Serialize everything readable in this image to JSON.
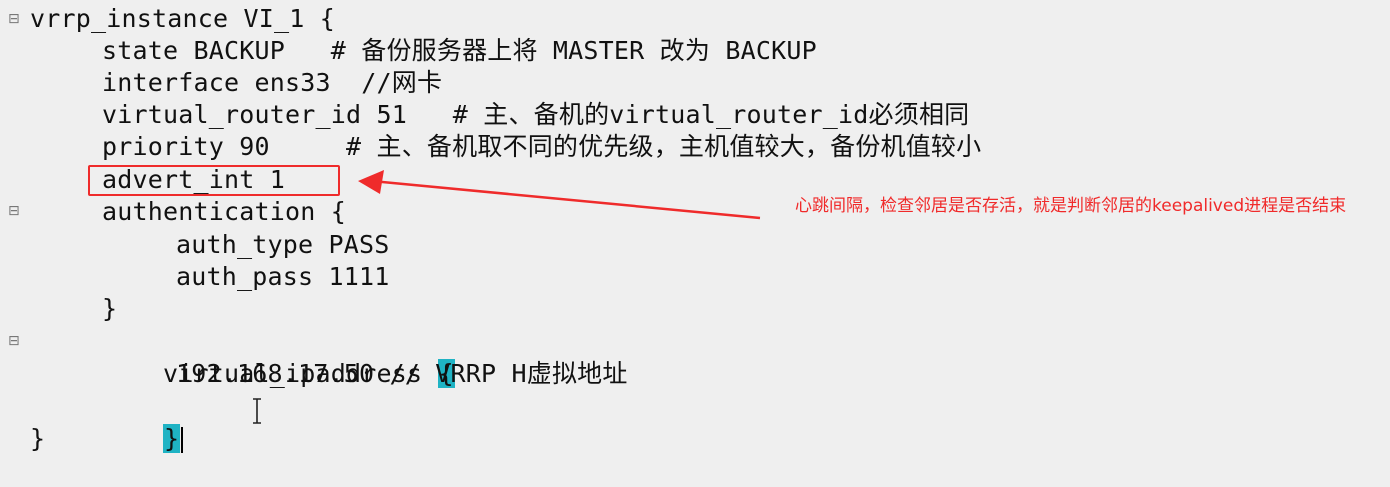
{
  "editor": {
    "lines": [
      {
        "indent": "",
        "text": "vrrp_instance VI_1 {",
        "fold": true
      },
      {
        "indent": "    ",
        "text": "state BACKUP   # 备份服务器上将 MASTER 改为 BACKUP",
        "fold": false
      },
      {
        "indent": "    ",
        "text": "interface ens33  //网卡",
        "fold": false
      },
      {
        "indent": "    ",
        "text": "virtual_router_id 51   # 主、备机的virtual_router_id必须相同",
        "fold": false
      },
      {
        "indent": "    ",
        "text": "priority 90     # 主、备机取不同的优先级，主机值较大，备份机值较小",
        "fold": false
      },
      {
        "indent": "    ",
        "text": "advert_int 1",
        "fold": false
      },
      {
        "indent": "    ",
        "text": "authentication {",
        "fold": true
      },
      {
        "indent": "        ",
        "text": "auth_type PASS",
        "fold": false
      },
      {
        "indent": "        ",
        "text": "auth_pass 1111",
        "fold": false
      },
      {
        "indent": "    ",
        "text": "}",
        "fold": false
      },
      {
        "indent": "    ",
        "text": "virtual_ipaddress ",
        "bracket": "{",
        "fold": true
      },
      {
        "indent": "        ",
        "text": "192.168.17.50 // VRRP H虚拟地址",
        "fold": false
      },
      {
        "indent": "    ",
        "text": "",
        "bracket": "}",
        "caret": true,
        "fold": false
      },
      {
        "indent": "",
        "text": "}",
        "fold": false
      }
    ]
  },
  "annotation": {
    "text": "心跳间隔，检查邻居是否存活，就是判断邻居的keepalived进程是否结束",
    "color": "#f02a2a"
  },
  "colors": {
    "background": "#efefef",
    "bracket_highlight": "#1fb3c4",
    "annotation_red": "#ef2b2b"
  },
  "icons": {
    "fold_marker": "minus-square-icon",
    "cursor": "text-ibeam-icon"
  }
}
